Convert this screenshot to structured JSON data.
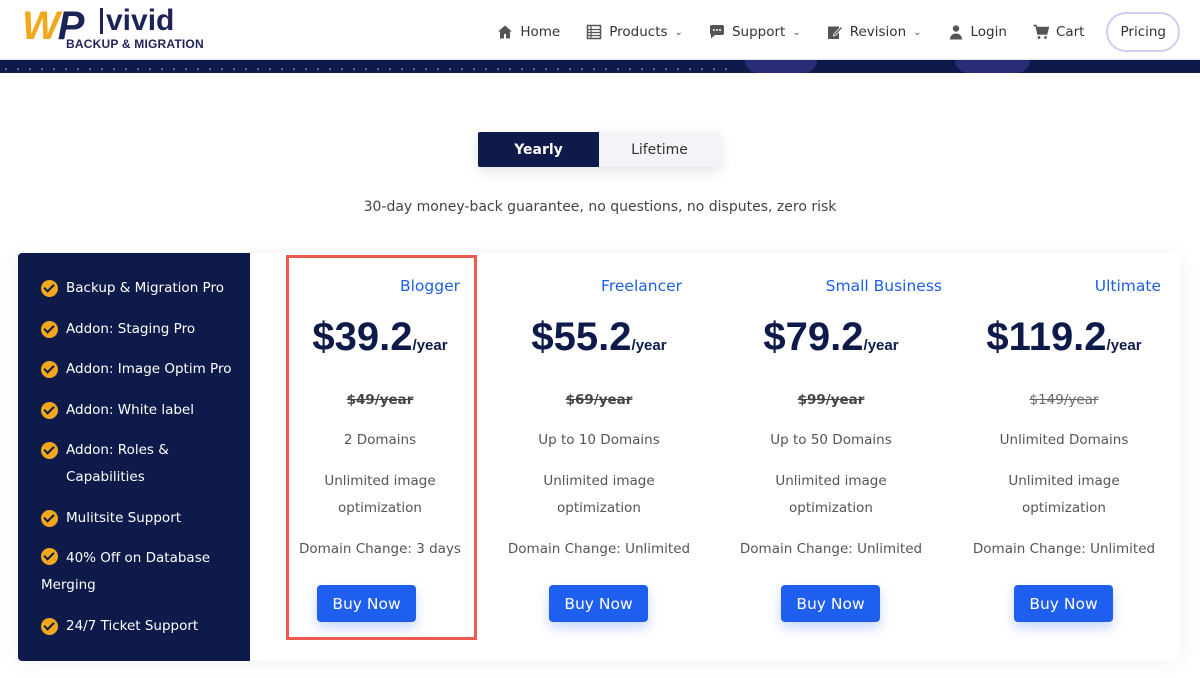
{
  "logo": {
    "wp_w": "W",
    "wp_p": "P",
    "brand": "vivid",
    "sub": "BACKUP & MIGRATION"
  },
  "nav": {
    "items": [
      {
        "label": "Home",
        "icon": "home-icon",
        "dropdown": false
      },
      {
        "label": "Products",
        "icon": "products-icon",
        "dropdown": true
      },
      {
        "label": "Support",
        "icon": "support-icon",
        "dropdown": true
      },
      {
        "label": "Revision",
        "icon": "revision-icon",
        "dropdown": true
      },
      {
        "label": "Login",
        "icon": "user-icon",
        "dropdown": false
      },
      {
        "label": "Cart",
        "icon": "cart-icon",
        "dropdown": false
      }
    ],
    "pricing": "Pricing"
  },
  "billing_toggle": {
    "yearly": "Yearly",
    "lifetime": "Lifetime",
    "selected": "Yearly"
  },
  "guarantee": "30-day money-back guarantee, no questions, no disputes, zero risk",
  "features": [
    "Backup & Migration Pro",
    "Addon: Staging Pro",
    "Addon: Image Optim Pro",
    "Addon: White label",
    "Addon: Roles & Capabilities",
    "Mulitsite Support",
    "40% Off on Database Merging",
    "24/7 Ticket Support"
  ],
  "plans": [
    {
      "name": "Blogger",
      "price": "$39.2",
      "per": "/year",
      "old_price": "$49/year",
      "domains": "2 Domains",
      "image_1": "Unlimited image",
      "image_2": "optimization",
      "domain_change": "Domain Change: 3 days",
      "button": "Buy Now"
    },
    {
      "name": "Freelancer",
      "price": "$55.2",
      "per": "/year",
      "old_price": "$69/year",
      "domains": "Up to 10 Domains",
      "image_1": "Unlimited image",
      "image_2": "optimization",
      "domain_change": "Domain Change: Unlimited",
      "button": "Buy Now"
    },
    {
      "name": "Small Business",
      "price": "$79.2",
      "per": "/year",
      "old_price": "$99/year",
      "domains": "Up to 50 Domains",
      "image_1": "Unlimited image",
      "image_2": "optimization",
      "domain_change": "Domain Change: Unlimited",
      "button": "Buy Now"
    },
    {
      "name": "Ultimate",
      "price": "$119.2",
      "per": "/year",
      "old_price": "$149/year",
      "domains": "Unlimited Domains",
      "image_1": "Unlimited image",
      "image_2": "optimization",
      "domain_change": "Domain Change: Unlimited",
      "button": "Buy Now"
    }
  ],
  "colors": {
    "navy": "#0e1a4a",
    "accent_blue": "#1f5ff0",
    "check_orange": "#f2a81d",
    "highlight_red": "#ee5a4f"
  }
}
